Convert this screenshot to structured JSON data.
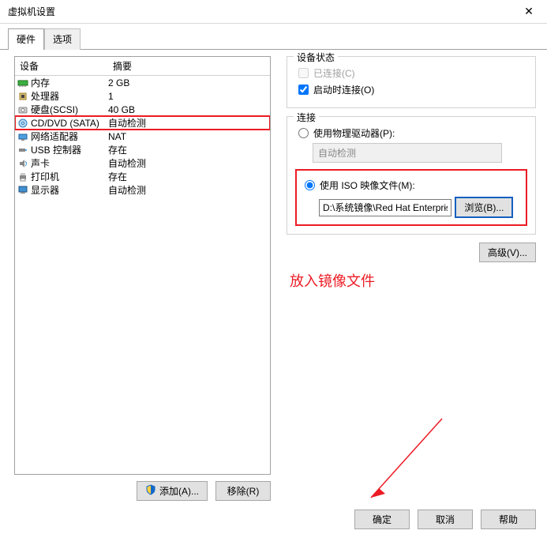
{
  "window": {
    "title": "虚拟机设置"
  },
  "tabs": {
    "hardware": "硬件",
    "options": "选项"
  },
  "hw": {
    "hdr_device": "设备",
    "hdr_summary": "摘要",
    "rows": [
      {
        "dev": "内存",
        "sum": "2 GB",
        "icon": "memory"
      },
      {
        "dev": "处理器",
        "sum": "1",
        "icon": "cpu"
      },
      {
        "dev": "硬盘(SCSI)",
        "sum": "40 GB",
        "icon": "disk"
      },
      {
        "dev": "CD/DVD (SATA)",
        "sum": "自动检测",
        "icon": "cd"
      },
      {
        "dev": "网络适配器",
        "sum": "NAT",
        "icon": "net"
      },
      {
        "dev": "USB 控制器",
        "sum": "存在",
        "icon": "usb"
      },
      {
        "dev": "声卡",
        "sum": "自动检测",
        "icon": "sound"
      },
      {
        "dev": "打印机",
        "sum": "存在",
        "icon": "printer"
      },
      {
        "dev": "显示器",
        "sum": "自动检测",
        "icon": "display"
      }
    ]
  },
  "btns": {
    "add": "添加(A)...",
    "remove": "移除(R)"
  },
  "devstate": {
    "label": "设备状态",
    "connected": "已连接(C)",
    "connect_poweron": "启动时连接(O)"
  },
  "conn": {
    "label": "连接",
    "use_physical": "使用物理驱动器(P):",
    "auto_detect": "自动检测",
    "use_iso": "使用 ISO 映像文件(M):",
    "iso_path": "D:\\系统镜像\\Red Hat Enterpris",
    "browse": "浏览(B)...",
    "advanced": "高级(V)..."
  },
  "annotation": "放入镜像文件",
  "footer": {
    "ok": "确定",
    "cancel": "取消",
    "help": "帮助"
  }
}
